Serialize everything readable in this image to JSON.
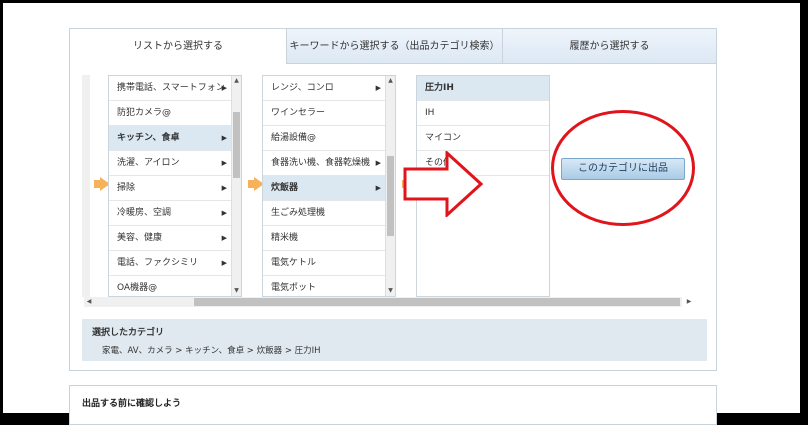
{
  "tabs": [
    {
      "label": "リストから選択する",
      "active": true
    },
    {
      "label": "キーワードから選択する（出品カテゴリ検索）",
      "active": false
    },
    {
      "label": "履歴から選択する",
      "active": false
    }
  ],
  "lists": {
    "col1": {
      "items": [
        {
          "label": "携帯電話、スマートフォン",
          "arrow": true,
          "selected": false
        },
        {
          "label": "防犯カメラ@",
          "arrow": false,
          "selected": false
        },
        {
          "label": "キッチン、食卓",
          "arrow": true,
          "selected": true
        },
        {
          "label": "洗濯、アイロン",
          "arrow": true,
          "selected": false
        },
        {
          "label": "掃除",
          "arrow": true,
          "selected": false
        },
        {
          "label": "冷暖房、空調",
          "arrow": true,
          "selected": false
        },
        {
          "label": "美容、健康",
          "arrow": true,
          "selected": false
        },
        {
          "label": "電話、ファクシミリ",
          "arrow": true,
          "selected": false
        },
        {
          "label": "OA機器@",
          "arrow": false,
          "selected": false
        }
      ]
    },
    "col2": {
      "items": [
        {
          "label": "レンジ、コンロ",
          "arrow": true,
          "selected": false
        },
        {
          "label": "ワインセラー",
          "arrow": false,
          "selected": false
        },
        {
          "label": "給湯設備@",
          "arrow": false,
          "selected": false
        },
        {
          "label": "食器洗い機、食器乾燥機",
          "arrow": true,
          "selected": false
        },
        {
          "label": "炊飯器",
          "arrow": true,
          "selected": true
        },
        {
          "label": "生ごみ処理機",
          "arrow": false,
          "selected": false
        },
        {
          "label": "精米機",
          "arrow": false,
          "selected": false
        },
        {
          "label": "電気ケトル",
          "arrow": false,
          "selected": false
        },
        {
          "label": "電気ポット",
          "arrow": false,
          "selected": false
        }
      ]
    },
    "col3": {
      "items": [
        {
          "label": "圧力IH",
          "selected": true
        },
        {
          "label": "IH",
          "selected": false
        },
        {
          "label": "マイコン",
          "selected": false
        },
        {
          "label": "その他",
          "selected": false
        }
      ]
    }
  },
  "submit_button": {
    "label": "このカテゴリに出品"
  },
  "selected_category": {
    "title": "選択したカテゴリ",
    "path": "家電、AV、カメラ > キッチン、食卓 > 炊飯器 > 圧力IH"
  },
  "confirm": {
    "title": "出品する前に確認しよう"
  },
  "colors": {
    "annotation_red": "#e1141c",
    "indicator_orange": "#f5b25a",
    "selected_bg": "#dce8f1",
    "button_blue": "#a9cbe6"
  },
  "icons": {
    "arrow": "chevron-right-icon",
    "indicator": "arrow-right-icon"
  }
}
